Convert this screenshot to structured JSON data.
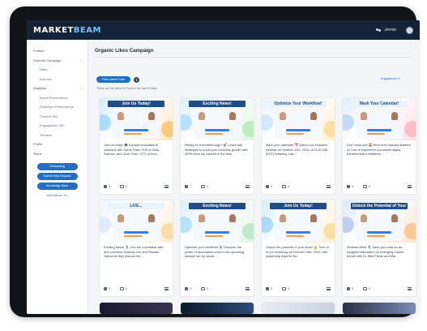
{
  "app": {
    "logo_main": "MARKET",
    "logo_accent": "BEAM",
    "user_name": "Jennie"
  },
  "sidebar": {
    "items": [
      {
        "label": "Feature",
        "type": "item"
      },
      {
        "label": "LinkedIn Campaign",
        "type": "group",
        "chev": "⌄"
      },
      {
        "label": "Likes",
        "type": "sub",
        "active": true
      },
      {
        "label": "Borrows",
        "type": "sub"
      },
      {
        "label": "Analytics",
        "type": "group",
        "chev": "⌄"
      },
      {
        "label": "Brand Performance",
        "type": "sub"
      },
      {
        "label": "Employee Performance",
        "type": "sub"
      },
      {
        "label": "Content 360",
        "type": "sub"
      },
      {
        "label": "Engagement 360",
        "type": "sub"
      },
      {
        "label": "Timeline",
        "type": "sub"
      },
      {
        "label": "Profile",
        "type": "item"
      },
      {
        "label": "Team",
        "type": "item"
      }
    ],
    "buttons": [
      "Onboarding",
      "Submit Help Request",
      "Knowledge Base"
    ],
    "copyright": "MarketBeam, Inc"
  },
  "main": {
    "title": "Organic Likes Campaign",
    "fetch_button": "Fetch latest Posts",
    "info": "i",
    "posts_note": "These are the latest 30 Posts in the last 30 days",
    "sort_label": "Engagement ▾"
  },
  "cards": [
    {
      "banner": "Join Us Today!",
      "banner_style": "dark",
      "caption": "Join us today! 🎓 Explore innovative AI solutions with Sarah Patel, PhD in Data Science, and John Chen, CTO of Inno...",
      "likes": "9",
      "comments": "0"
    },
    {
      "banner": "Exciting News!",
      "banner_style": "dark",
      "caption": "Ready for a breakthrough? 🚀 Leave day strategies to boost your business growth with 200% from top experts in the field.",
      "likes": "7",
      "comments": "0"
    },
    {
      "banner": "Optimize Your Workflow!",
      "banner_style": "light",
      "caption": "Mark your calendar! 📅 Attend our exclusive webinar on October 12th, 2024, at 11:00 AM (EST) featuring Lisa...",
      "likes": "4",
      "comments": "0"
    },
    {
      "banner": "Mark Your Calendar!",
      "banner_style": "light",
      "caption": "Don't miss out! 🚨 Hear from industry leaders on how to implement successful digital transformation initiatives ...",
      "likes": "4",
      "comments": "0"
    },
    {
      "banner": "LIVE...",
      "banner_style": "light",
      "caption": "Exciting News! 🎙️ Join the roundtable with tech pioneers Amanda Lee and Ricardo Garcia as they discuss the ...",
      "likes": "3",
      "comments": "0"
    },
    {
      "banner": "Exciting News!",
      "banner_style": "dark",
      "caption": "Optimize your workflow! ⚙️ Discover the power of automation tools in our upcoming session led by Jacob ...",
      "likes": "3",
      "comments": "0"
    },
    {
      "banner": "Join Us Today!",
      "banner_style": "dark",
      "caption": "Unlock the potential of your team! 🔓 Tune in to our workshop on October 15th, 2024, with leadership experts Sa...",
      "likes": "3",
      "comments": "0"
    },
    {
      "banner": "Unlock the Potential of Your Team",
      "banner_style": "dark",
      "caption": "Webinar Alert! 🎙️ Save your seat for an insightful discussion on emerging market trends with Dr. Ellie Fisher and Mar...",
      "likes": "3",
      "comments": "0"
    }
  ],
  "colors": {
    "topbar": "#142338",
    "accent": "#1f6fc5",
    "logo_accent": "#6fc3ff"
  }
}
